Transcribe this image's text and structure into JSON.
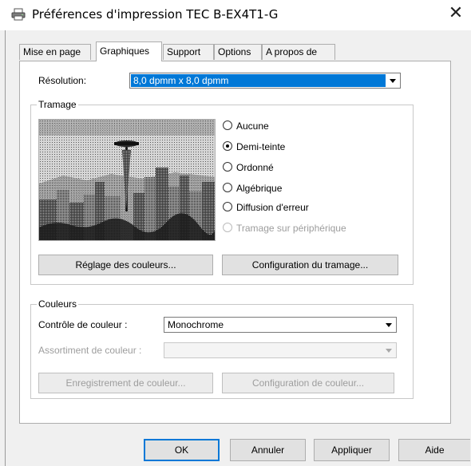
{
  "window": {
    "title": "Préférences d'impression TEC B-EX4T1-G",
    "close_glyph": "✕",
    "icon": "printer-icon"
  },
  "tabs": [
    {
      "label": "Mise en page",
      "active": false
    },
    {
      "label": "Graphiques",
      "active": true
    },
    {
      "label": "Support",
      "active": false
    },
    {
      "label": "Options",
      "active": false
    },
    {
      "label": "A propos de",
      "active": false
    }
  ],
  "resolution": {
    "label": "Résolution:",
    "value": "8,0 dpmm x 8,0 dpmm"
  },
  "dithering": {
    "group_title": "Tramage",
    "preview_image": "city-skyline-halftone-preview",
    "options": [
      {
        "label": "Aucune",
        "checked": false,
        "enabled": true
      },
      {
        "label": "Demi-teinte",
        "checked": true,
        "enabled": true
      },
      {
        "label": "Ordonné",
        "checked": false,
        "enabled": true
      },
      {
        "label": "Algébrique",
        "checked": false,
        "enabled": true
      },
      {
        "label": "Diffusion d'erreur",
        "checked": false,
        "enabled": true
      },
      {
        "label": "Tramage sur périphérique",
        "checked": false,
        "enabled": false
      }
    ],
    "color_adjust_button": "Réglage des couleurs...",
    "dither_config_button": "Configuration du tramage..."
  },
  "colors": {
    "group_title": "Couleurs",
    "control_label": "Contrôle de couleur :",
    "control_value": "Monochrome",
    "match_label": "Assortiment de couleur :",
    "match_value": "",
    "save_button": "Enregistrement de couleur...",
    "config_button": "Configuration de couleur..."
  },
  "footer": {
    "ok": "OK",
    "cancel": "Annuler",
    "apply": "Appliquer",
    "help": "Aide"
  },
  "accent_color": "#0078d7"
}
